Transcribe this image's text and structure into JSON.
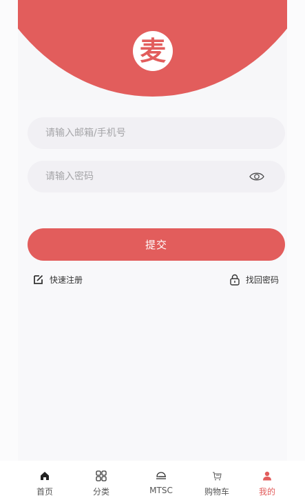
{
  "login": {
    "email_placeholder": "请输入邮箱/手机号",
    "password_placeholder": "请输入密码",
    "submit_label": "提交",
    "register_label": "快速注册",
    "forgot_label": "找回密码",
    "logo_text": "麦"
  },
  "tabbar": {
    "items": [
      {
        "label": "首页",
        "icon": "home-icon"
      },
      {
        "label": "分类",
        "icon": "grid-icon"
      },
      {
        "label": "MTSC",
        "icon": "mtsc-icon"
      },
      {
        "label": "购物车",
        "icon": "cart-icon"
      },
      {
        "label": "我的",
        "icon": "user-icon",
        "active": true
      }
    ]
  },
  "colors": {
    "brand": "#e25d5c",
    "field_bg": "#f1f0f4",
    "placeholder": "#a5a5a8"
  }
}
